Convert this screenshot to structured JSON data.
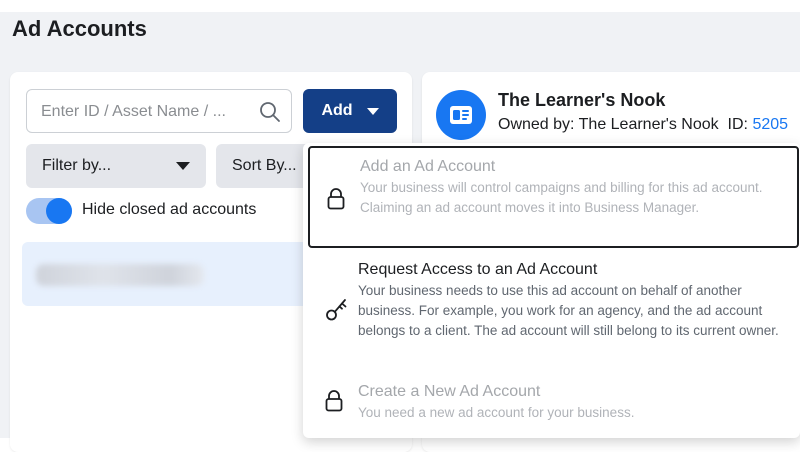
{
  "page": {
    "title": "Ad Accounts"
  },
  "search": {
    "placeholder": "Enter ID / Asset Name / ...",
    "value": ""
  },
  "toolbar": {
    "add_label": "Add"
  },
  "filters": {
    "filter_label": "Filter by...",
    "sort_label": "Sort By..."
  },
  "toggle": {
    "label": "Hide closed ad accounts",
    "on": true
  },
  "business": {
    "name": "The Learner's Nook",
    "owner_prefix": "Owned by: The Learner's Nook",
    "id_label": "ID:",
    "id_value": "5205"
  },
  "add_menu": {
    "items": [
      {
        "title": "Add an Ad Account",
        "description": "Your business will control campaigns and billing for this ad account. Claiming an ad account moves it into Business Manager.",
        "icon": "lock-icon",
        "disabled": true
      },
      {
        "title": "Request Access to an Ad Account",
        "description": "Your business needs to use this ad account on behalf of another business. For example, you work for an agency, and the ad account belongs to a client. The ad account will still belong to its current owner.",
        "icon": "key-icon",
        "disabled": false
      },
      {
        "title": "Create a New Ad Account",
        "description": "You need a new ad account for your business.",
        "icon": "lock-icon",
        "disabled": true
      }
    ]
  },
  "colors": {
    "primary": "#143f87",
    "accent": "#1877f2",
    "background": "#f0f2f5"
  }
}
